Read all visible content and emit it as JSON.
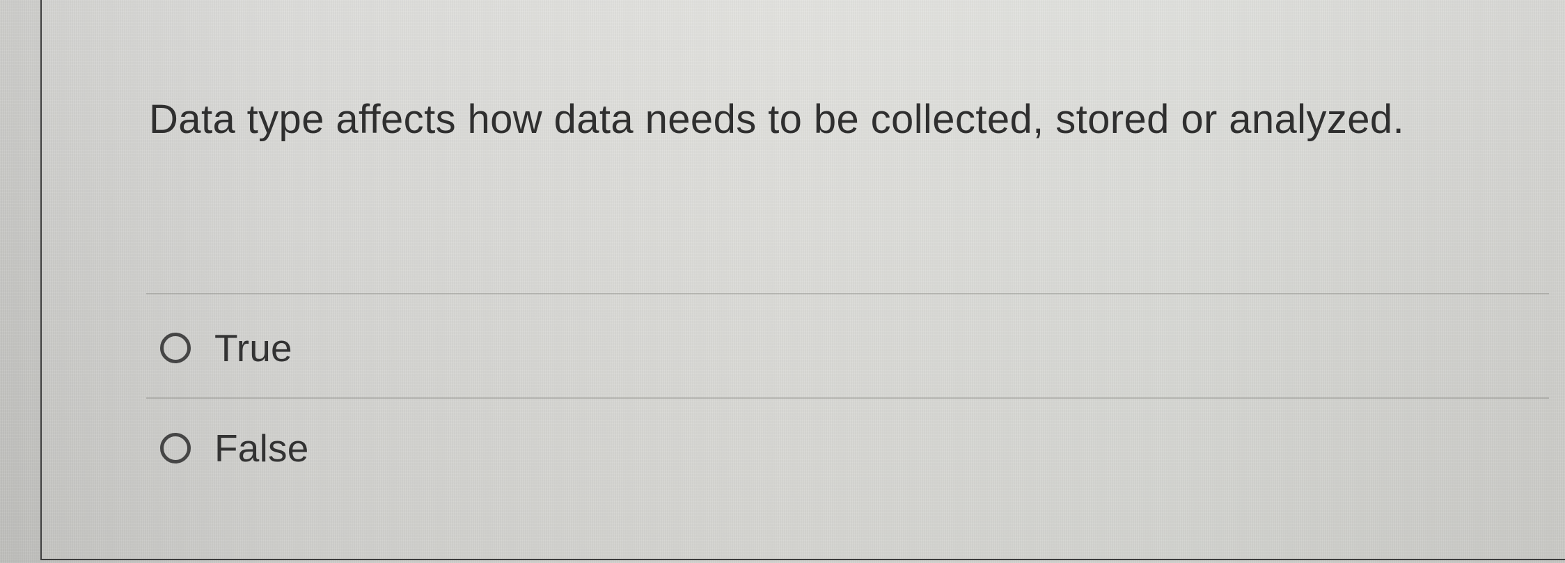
{
  "question": {
    "text": "Data type affects how data needs to be collected, stored or analyzed."
  },
  "answers": [
    {
      "label": "True",
      "selected": false
    },
    {
      "label": "False",
      "selected": false
    }
  ],
  "icons": {
    "radio": "radio-button-icon"
  },
  "colors": {
    "text": "#2f2f2f",
    "background": "#d8d8d4",
    "border": "#3d3d3d"
  }
}
